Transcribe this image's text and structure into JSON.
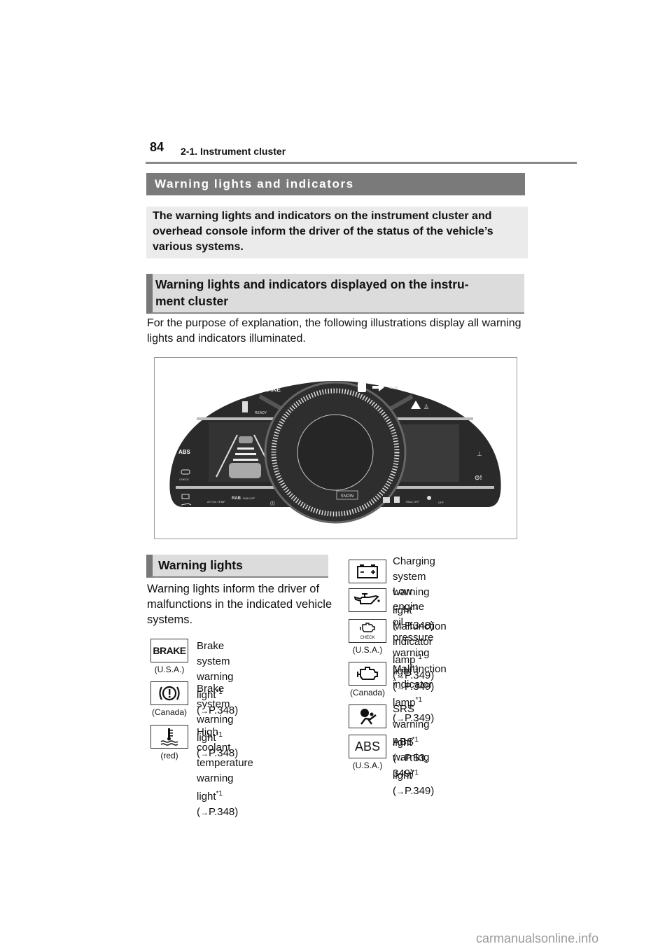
{
  "header": {
    "page_number": "84",
    "section": "2-1. Instrument cluster"
  },
  "title": "Warning lights and indicators",
  "intro": "The warning lights and indicators on the instrument cluster and overhead console inform the driver of the status of the vehicle’s various systems.",
  "subheading_cluster": "Warning lights and indicators displayed on the instru-ment cluster",
  "subheading_cluster_line1": "Warning lights and indicators displayed on the instru-",
  "subheading_cluster_line2": "ment cluster",
  "purpose_text": "For the purpose of explanation, the following illustrations display all warning lights and indicators illuminated.",
  "cluster": {
    "top_labels": {
      "brake": "BRAKE",
      "ready": "READY"
    },
    "left_labels": {
      "abs": "ABS",
      "check": "CHECK"
    },
    "bottom_left_labels": {
      "at_oil_temp": "A/T OIL TEMP",
      "rab": "RAB",
      "rab_off": "RAB OFF"
    },
    "bottom_mid_labels": {
      "snow": "SNOW"
    },
    "bottom_right_labels": {
      "trac_off": "TRAC OFF",
      "off": "OFF"
    },
    "colors": {
      "panel": "#2a2a2a",
      "bezel": "#555555",
      "icon": "#ffffff"
    }
  },
  "warning_lights": {
    "heading": "Warning lights",
    "intro": "Warning lights inform the driver of malfunctions in the indicated vehicle systems.",
    "left_items": [
      {
        "icon": "brake-text-icon",
        "icon_text": "BRAKE",
        "caption": "(U.S.A.)",
        "line1": "Brake system warning",
        "line2_pre": "light",
        "sup": "*1",
        "ref": "P.348"
      },
      {
        "icon": "brake-circle-icon",
        "icon_text": "(!)",
        "caption": "(Canada)",
        "line1": "Brake system warning",
        "line2_pre": "light",
        "sup": "*1",
        "ref": "P.348"
      },
      {
        "icon": "coolant-temp-icon",
        "caption": "(red)",
        "line1": "High coolant temperature",
        "line2_pre": "warning light",
        "sup": "*1",
        "ref": "P.348"
      }
    ],
    "right_items": [
      {
        "icon": "battery-icon",
        "caption": "",
        "line1": "Charging system warning",
        "line2_pre": "light",
        "sup": "*1",
        "ref": "P.348"
      },
      {
        "icon": "oil-can-icon",
        "caption": "",
        "line1": "Low engine oil pressure",
        "line2_pre": "warning light",
        "sup": "*1",
        "ref": "P.349"
      },
      {
        "icon": "engine-check-icon",
        "icon_text": "CHECK",
        "caption": "(U.S.A.)",
        "line1": "Malfunction indicator",
        "line2_pre": "lamp",
        "sup": "*1",
        "ref": "P.349"
      },
      {
        "icon": "engine-icon",
        "caption": "(Canada)",
        "line1": "Malfunction indicator",
        "line2_pre": "lamp",
        "sup": "*1",
        "ref": "P.349"
      },
      {
        "icon": "airbag-icon",
        "caption": "",
        "line1_pre": "SRS warning light",
        "sup": "*1",
        "line2": "P.53, 349"
      },
      {
        "icon": "abs-icon",
        "icon_text": "ABS",
        "caption": "(U.S.A.)",
        "line1_pre": "ABS warning light",
        "sup": "*1",
        "line2": "P.349"
      }
    ]
  },
  "watermark": "carmanualsonline.info"
}
